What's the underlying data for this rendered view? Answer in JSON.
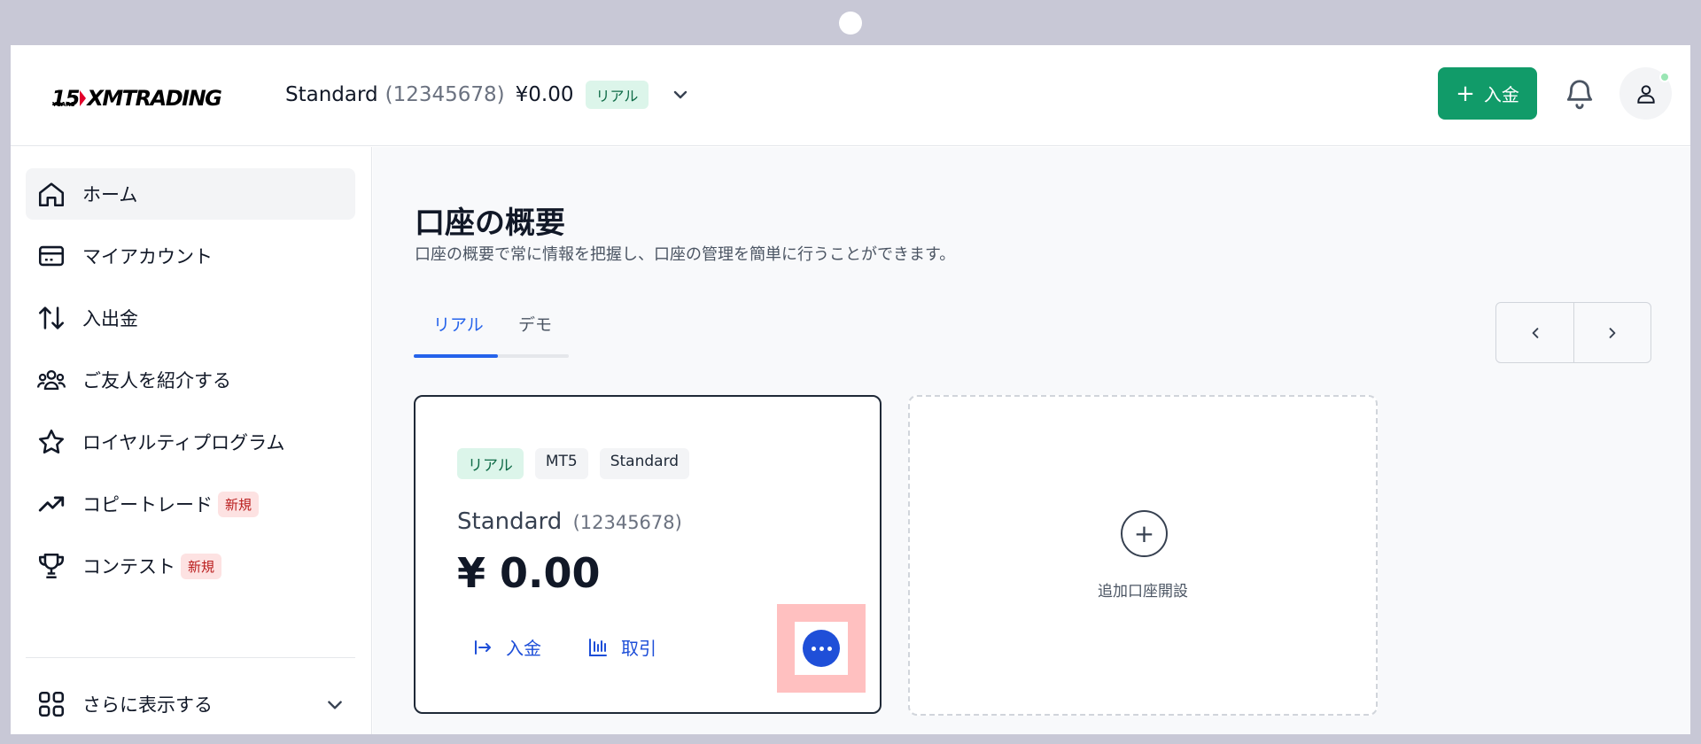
{
  "header": {
    "logo": {
      "years": "15",
      "years_sub": "YEARS",
      "brand": "XMTRADING"
    },
    "account": {
      "name": "Standard",
      "number": "(12345678)",
      "balance": "¥0.00",
      "type_badge": "リアル"
    },
    "deposit_button": {
      "plus": "+",
      "label": "入金"
    },
    "icons": {
      "chevron": "chevron-down-icon",
      "bell": "bell-icon",
      "user": "user-icon"
    }
  },
  "sidebar": {
    "items": [
      {
        "label": "ホーム",
        "icon": "home-icon",
        "active": true
      },
      {
        "label": "マイアカウント",
        "icon": "card-icon"
      },
      {
        "label": "入出金",
        "icon": "arrows-updown-icon"
      },
      {
        "label": "ご友人を紹介する",
        "icon": "users-icon"
      },
      {
        "label": "ロイヤルティプログラム",
        "icon": "star-icon"
      },
      {
        "label": "コピートレード",
        "icon": "trend-up-icon",
        "badge": "新規"
      },
      {
        "label": "コンテスト",
        "icon": "trophy-icon",
        "badge": "新規"
      }
    ],
    "more": {
      "label": "さらに表示する",
      "icon": "grid-icon"
    }
  },
  "main": {
    "title": "口座の概要",
    "subtitle": "口座の概要で常に情報を把握し、口座の管理を簡単に行うことができます。",
    "tabs": [
      {
        "label": "リアル",
        "active": true
      },
      {
        "label": "デモ"
      }
    ],
    "pager": {
      "prev": "chevron-left-icon",
      "next": "chevron-right-icon"
    },
    "account_card": {
      "chips": [
        "リアル",
        "MT5",
        "Standard"
      ],
      "name": "Standard",
      "number": "(12345678)",
      "balance": "¥ 0.00",
      "actions": {
        "deposit": "入金",
        "trade": "取引"
      },
      "more_icon": "more-horizontal-icon"
    },
    "add_card": {
      "plus": "+",
      "label": "追加口座開設"
    }
  },
  "colors": {
    "accent_green": "#119b69",
    "accent_blue": "#2563eb",
    "highlight": "#ffc0c0"
  }
}
